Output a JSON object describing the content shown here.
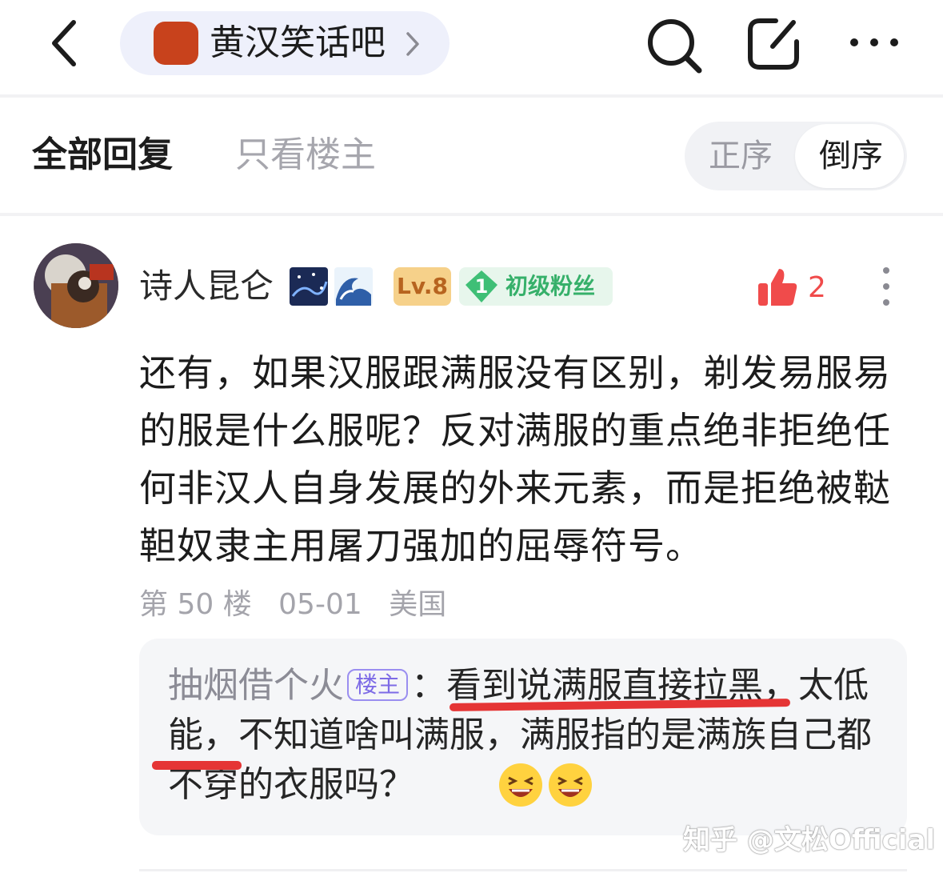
{
  "topbar": {
    "forum_name": "黄汉笑话吧",
    "icons": [
      "back-arrow-icon",
      "chevron-right-icon",
      "search-icon",
      "compose-icon",
      "more-icon"
    ],
    "accent_color": "#c8421c"
  },
  "tabs": {
    "all_replies": "全部回复",
    "op_only": "只看楼主",
    "sort_asc": "正序",
    "sort_desc": "倒序",
    "selected_sort": "倒序"
  },
  "post": {
    "username": "诗人昆仑",
    "level": "Lv.8",
    "fan_level": "1",
    "fan_title": "初级粉丝",
    "like_count": "2",
    "body": "还有，如果汉服跟满服没有区别，剃发易服易的服是什么服呢？反对满服的重点绝非拒绝任何非汉人自身发展的外来元素，而是拒绝被鞑靼奴隶主用屠刀强加的屈辱符号。",
    "floor": "第 50 楼",
    "date": "05-01",
    "location": "美国"
  },
  "reply": {
    "author": "抽烟借个火",
    "op_tag": "楼主",
    "colon": "：",
    "text": "看到说满服直接拉黑，太低能，不知道啥叫满服，满服指的是满族自己都不穿的衣服吗？"
  },
  "watermark": "知乎 @文松Official"
}
